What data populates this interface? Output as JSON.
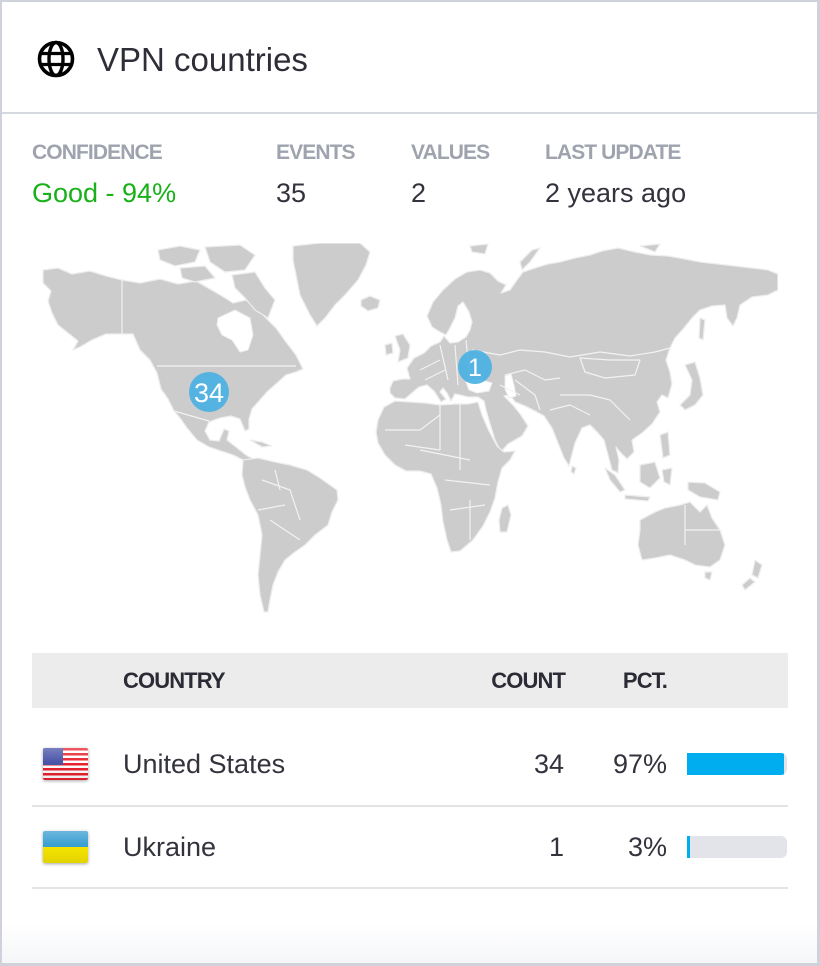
{
  "widget": {
    "title": "VPN countries",
    "icon": "globe-icon"
  },
  "stats": [
    {
      "label": "CONFIDENCE",
      "value": "Good - 94%",
      "color": "#19b019"
    },
    {
      "label": "EVENTS",
      "value": "35"
    },
    {
      "label": "VALUES",
      "value": "2"
    },
    {
      "label": "LAST UPDATE",
      "value": "2 years ago"
    }
  ],
  "map": {
    "marker_color": "#48b0e3",
    "markers": [
      {
        "country": "United States",
        "count": "34"
      },
      {
        "country": "Ukraine",
        "count": "1"
      }
    ]
  },
  "table": {
    "columns": {
      "country": "COUNTRY",
      "count": "COUNT",
      "pct": "PCT."
    },
    "bar_color": "#00aeef",
    "track_color": "#e2e4ea",
    "rows": [
      {
        "flag": "us-flag-icon",
        "country": "United States",
        "count": "34",
        "pct": "97%",
        "fraction": 0.97
      },
      {
        "flag": "ua-flag-icon",
        "country": "Ukraine",
        "count": "1",
        "pct": "3%",
        "fraction": 0.03
      }
    ]
  }
}
